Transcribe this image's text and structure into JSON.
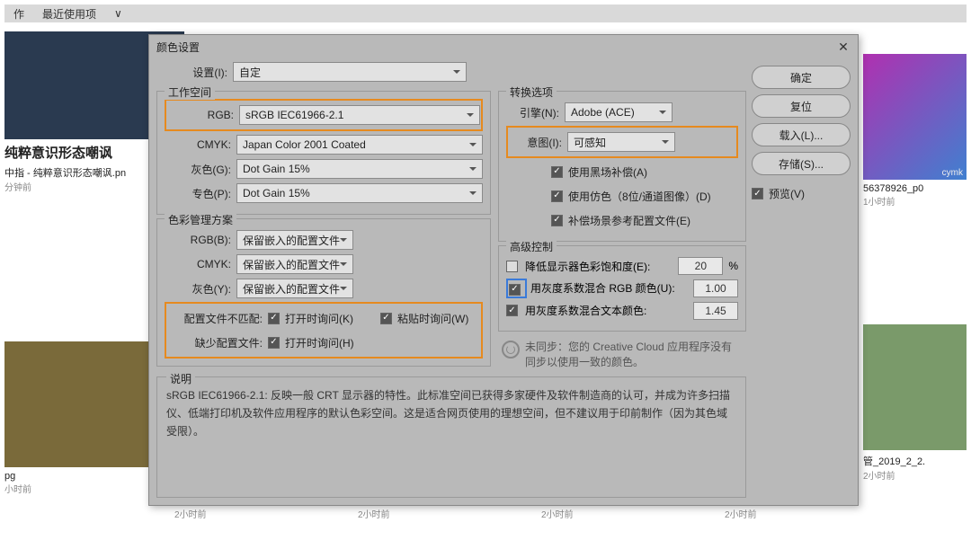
{
  "background": {
    "toolbar": {
      "label1": "作",
      "label2": "最近使用项",
      "chevron": "∨"
    },
    "cards": [
      {
        "title": "纯粹意识形态嘲讽",
        "sub": "中指 - 纯粹意识形态嘲讽.pn",
        "time": "分钟前"
      },
      {
        "title": "",
        "sub": "pg",
        "time": "小时前"
      },
      {
        "title": "",
        "sub": "",
        "time": "2小时前"
      },
      {
        "title": "",
        "sub": "",
        "time": "2小时前"
      },
      {
        "title": "",
        "sub": "",
        "time": "2小时前"
      },
      {
        "title": "",
        "sub": "",
        "time": "2小时前"
      }
    ],
    "right": [
      {
        "title": "56378926_p0",
        "time": "1小时前",
        "sub": "cymk"
      },
      {
        "title": "管_2019_2_2.",
        "time": "2小时前"
      }
    ]
  },
  "dialog": {
    "title": "颜色设置",
    "settings_label": "设置(I):",
    "settings_value": "自定",
    "workspace": {
      "legend": "工作空间",
      "rgb_label": "RGB:",
      "rgb_value": "sRGB IEC61966-2.1",
      "cmyk_label": "CMYK:",
      "cmyk_value": "Japan Color 2001 Coated",
      "gray_label": "灰色(G):",
      "gray_value": "Dot Gain 15%",
      "spot_label": "专色(P):",
      "spot_value": "Dot Gain 15%"
    },
    "policy": {
      "legend": "色彩管理方案",
      "rgb_label": "RGB(B):",
      "rgb_value": "保留嵌入的配置文件",
      "cmyk_label": "CMYK:",
      "cmyk_value": "保留嵌入的配置文件",
      "gray_label": "灰色(Y):",
      "gray_value": "保留嵌入的配置文件",
      "mismatch_label": "配置文件不匹配:",
      "ask_open": "打开时询问(K)",
      "ask_paste": "粘贴时询问(W)",
      "missing_label": "缺少配置文件:",
      "ask_open2": "打开时询问(H)"
    },
    "convert": {
      "legend": "转换选项",
      "engine_label": "引擎(N):",
      "engine_value": "Adobe (ACE)",
      "intent_label": "意图(I):",
      "intent_value": "可感知",
      "bpc": "使用黑场补偿(A)",
      "dither": "使用仿色（8位/通道图像）(D)",
      "scene": "补偿场景参考配置文件(E)"
    },
    "advanced": {
      "legend": "高级控制",
      "desat": "降低显示器色彩饱和度(E):",
      "desat_val": "20",
      "pct": "%",
      "blend_rgb": "用灰度系数混合 RGB 颜色(U):",
      "blend_rgb_val": "1.00",
      "blend_text": "用灰度系数混合文本颜色:",
      "blend_text_val": "1.45"
    },
    "sync_note": "未同步：您的 Creative Cloud 应用程序没有同步以使用一致的颜色。",
    "desc": {
      "legend": "说明",
      "text": "sRGB IEC61966-2.1: 反映一般 CRT 显示器的特性。此标准空间已获得多家硬件及软件制造商的认可，并成为许多扫描仪、低端打印机及软件应用程序的默认色彩空间。这是适合网页使用的理想空间，但不建议用于印前制作（因为其色域受限）。"
    },
    "buttons": {
      "ok": "确定",
      "reset": "复位",
      "load": "载入(L)...",
      "save": "存储(S)...",
      "preview": "预览(V)"
    }
  }
}
